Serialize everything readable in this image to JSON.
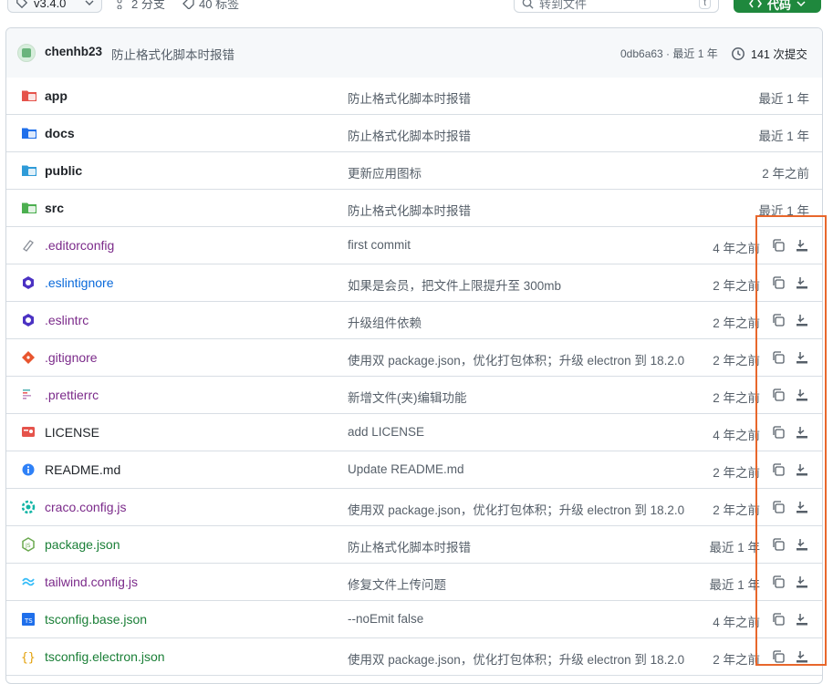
{
  "toolbar": {
    "branch": "v3.4.0",
    "branches": "2 分支",
    "tags": "40 标签",
    "goto_placeholder": "转到文件",
    "goto_kbd": "t",
    "code_label": "代码"
  },
  "commit": {
    "author": "chenhb23",
    "message": "防止格式化脚本时报错",
    "hash_time": "0db6a63 · 最近 1 年",
    "count": "141 次提交"
  },
  "rows": [
    {
      "name": "app",
      "type": "dir",
      "msg": "防止格式化脚本时报错",
      "time": "最近 1 年",
      "icon": "folder-red-icon",
      "color": "#e5534b"
    },
    {
      "name": "docs",
      "type": "dir",
      "msg": "防止格式化脚本时报错",
      "time": "最近 1 年",
      "icon": "folder-blue-icon",
      "color": "#1f6feb"
    },
    {
      "name": "public",
      "type": "dir",
      "msg": "更新应用图标",
      "time": "2 年之前",
      "icon": "folder-globe-icon",
      "color": "#2f9bd8"
    },
    {
      "name": "src",
      "type": "dir",
      "msg": "防止格式化脚本时报错",
      "time": "最近 1 年",
      "icon": "folder-green-icon",
      "color": "#4caf50"
    },
    {
      "name": ".editorconfig",
      "type": "file",
      "msg": "first commit",
      "time": "4 年之前",
      "icon": "editorconfig-icon",
      "color": "#8a8f98",
      "namecolor": "#7b2a8a"
    },
    {
      "name": ".eslintignore",
      "type": "file",
      "msg": "如果是会员，把文件上限提升至 300mb",
      "time": "2 年之前",
      "icon": "eslint-icon",
      "color": "#4b32c3",
      "namecolor": "#0969da"
    },
    {
      "name": ".eslintrc",
      "type": "file",
      "msg": "升级组件依赖",
      "time": "2 年之前",
      "icon": "eslint-icon",
      "color": "#4b32c3",
      "namecolor": "#7b2a8a"
    },
    {
      "name": ".gitignore",
      "type": "file",
      "msg": "使用双 package.json，优化打包体积；升级 electron 到 18.2.0",
      "time": "2 年之前",
      "icon": "git-icon",
      "color": "#e8552f",
      "namecolor": "#7b2a8a"
    },
    {
      "name": ".prettierrc",
      "type": "file",
      "msg": "新增文件(夹)编辑功能",
      "time": "2 年之前",
      "icon": "prettier-icon",
      "color": "#c596c7",
      "namecolor": "#7b2a8a"
    },
    {
      "name": "LICENSE",
      "type": "file",
      "msg": "add LICENSE",
      "time": "4 年之前",
      "icon": "license-icon",
      "color": "#e5534b",
      "namecolor": "#1f2328"
    },
    {
      "name": "README.md",
      "type": "file",
      "msg": "Update README.md",
      "time": "2 年之前",
      "icon": "info-icon",
      "color": "#2f81f7",
      "namecolor": "#1f2328"
    },
    {
      "name": "craco.config.js",
      "type": "file",
      "msg": "使用双 package.json，优化打包体积；升级 electron 到 18.2.0",
      "time": "2 年之前",
      "icon": "gear-icon",
      "color": "#12b5a5",
      "namecolor": "#7b2a8a"
    },
    {
      "name": "package.json",
      "type": "file",
      "msg": "防止格式化脚本时报错",
      "time": "最近 1 年",
      "icon": "nodejs-icon",
      "color": "#6aa84f",
      "namecolor": "#1a7f37"
    },
    {
      "name": "tailwind.config.js",
      "type": "file",
      "msg": "修复文件上传问题",
      "time": "最近 1 年",
      "icon": "tailwind-icon",
      "color": "#38bdf8",
      "namecolor": "#7b2a8a"
    },
    {
      "name": "tsconfig.base.json",
      "type": "file",
      "msg": "--noEmit false",
      "time": "4 年之前",
      "icon": "tsconfig-icon",
      "color": "#1f6feb",
      "namecolor": "#1a7f37"
    },
    {
      "name": "tsconfig.electron.json",
      "type": "file",
      "msg": "使用双 package.json，优化打包体积；升级 electron 到 18.2.0",
      "time": "2 年之前",
      "icon": "json-braces-icon",
      "color": "#e3a008",
      "namecolor": "#1a7f37"
    }
  ]
}
